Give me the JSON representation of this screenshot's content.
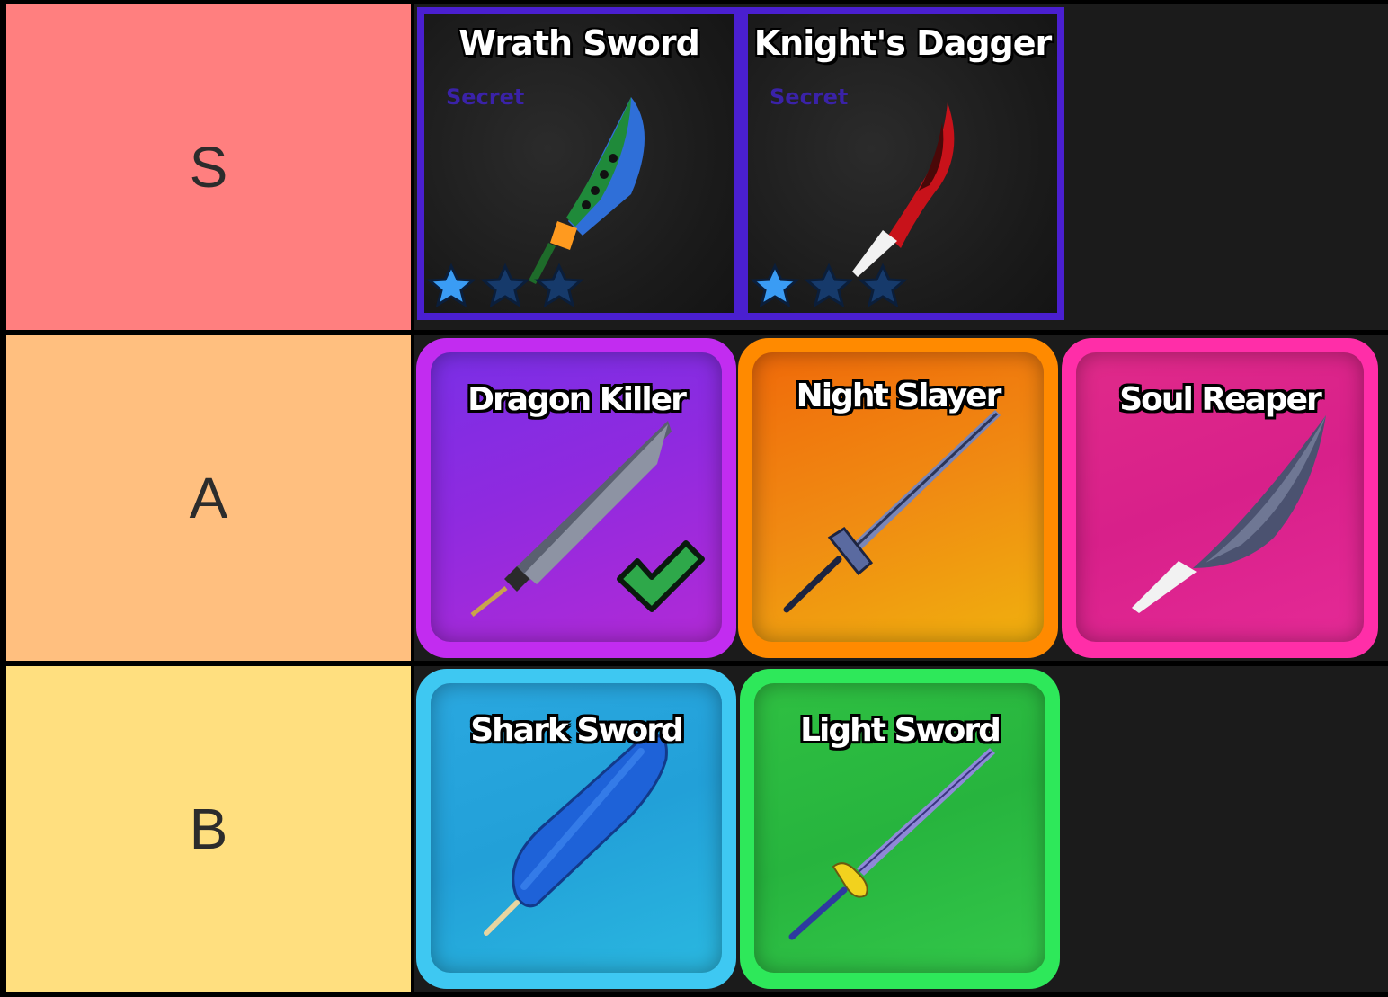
{
  "tiers": [
    {
      "label": "S",
      "color": "#ff7f7f",
      "items": [
        {
          "name": "Wrath Sword",
          "rarity": "Secret",
          "stars_filled": 1,
          "stars_total": 3
        },
        {
          "name": "Knight's Dagger",
          "rarity": "Secret",
          "stars_filled": 1,
          "stars_total": 3
        }
      ]
    },
    {
      "label": "A",
      "color": "#ffbf7f",
      "items": [
        {
          "name": "Dragon Killer",
          "frame_color": "#c22cf0",
          "owned": true
        },
        {
          "name": "Night Slayer",
          "frame_color": "#ff8a00"
        },
        {
          "name": "Soul Reaper",
          "frame_color": "#ff2ea8"
        }
      ]
    },
    {
      "label": "B",
      "color": "#ffdf7f",
      "items": [
        {
          "name": "Shark Sword",
          "frame_color": "#3ec8f2"
        },
        {
          "name": "Light Sword",
          "frame_color": "#2ee85a"
        }
      ]
    }
  ],
  "colors": {
    "secret_frame": "#4a1fd0",
    "secret_text": "#3a22a8",
    "items_bg": "#1b1b1b"
  }
}
